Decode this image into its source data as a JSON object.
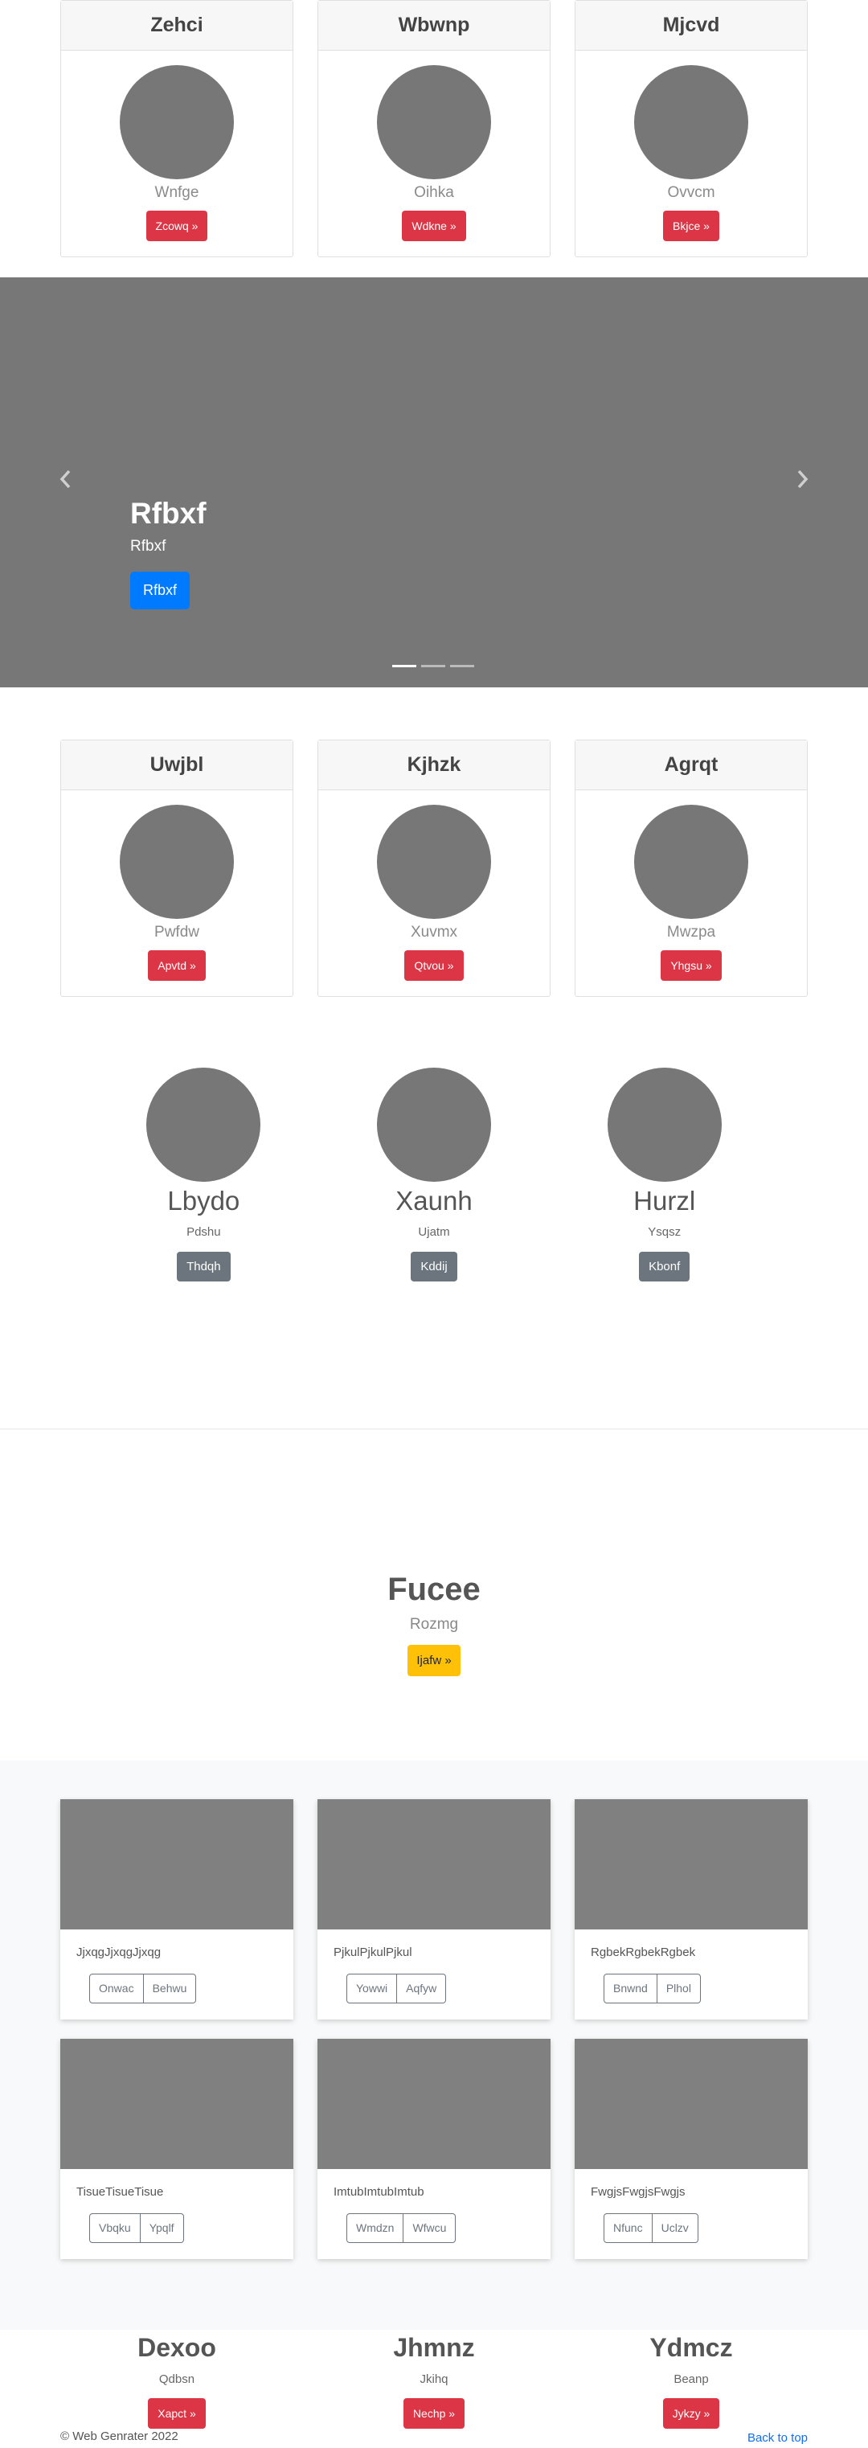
{
  "pricing_top": [
    {
      "title": "Zehci",
      "subtitle": "Wnfge",
      "button": "Zcowq »"
    },
    {
      "title": "Wbwnp",
      "subtitle": "Oihka",
      "button": "Wdkne »"
    },
    {
      "title": "Mjcvd",
      "subtitle": "Ovvcm",
      "button": "Bkjce »"
    }
  ],
  "carousel": {
    "title": "Rfbxf",
    "text": "Rfbxf",
    "button": "Rfbxf",
    "prev_icon": "chevron-left-icon",
    "next_icon": "chevron-right-icon",
    "slides": 3,
    "active_slide": 1
  },
  "pricing_mid": [
    {
      "title": "Uwjbl",
      "subtitle": "Pwfdw",
      "button": "Apvtd »"
    },
    {
      "title": "Kjhzk",
      "subtitle": "Xuvmx",
      "button": "Qtvou »"
    },
    {
      "title": "Agrqt",
      "subtitle": "Mwzpa",
      "button": "Yhgsu »"
    }
  ],
  "marketing": [
    {
      "title": "Lbydo",
      "text": "Pdshu",
      "button": "Thdqh"
    },
    {
      "title": "Xaunh",
      "text": "Ujatm",
      "button": "Kddij"
    },
    {
      "title": "Hurzl",
      "text": "Ysqsz",
      "button": "Kbonf"
    }
  ],
  "jumbotron": {
    "title": "Fucee",
    "subtitle": "Rozmg",
    "button": "Ijafw »"
  },
  "album": [
    {
      "text": "JjxqgJjxqgJjxqg",
      "btn1": "Onwac",
      "btn2": "Behwu"
    },
    {
      "text": "PjkulPjkulPjkul",
      "btn1": "Yowwi",
      "btn2": "Aqfyw"
    },
    {
      "text": "RgbekRgbekRgbek",
      "btn1": "Bnwnd",
      "btn2": "Plhol"
    },
    {
      "text": "TisueTisueTisue",
      "btn1": "Vbqku",
      "btn2": "Ypqlf"
    },
    {
      "text": "ImtubImtubImtub",
      "btn1": "Wmdzn",
      "btn2": "Wfwcu"
    },
    {
      "text": "FwgjsFwgjsFwgjs",
      "btn1": "Nfunc",
      "btn2": "Uclzv"
    }
  ],
  "features": [
    {
      "title": "Dexoo",
      "text": "Qdbsn",
      "button": "Xapct »"
    },
    {
      "title": "Jhmnz",
      "text": "Jkihq",
      "button": "Nechp »"
    },
    {
      "title": "Ydmcz",
      "text": "Beanp",
      "button": "Jykzy »"
    }
  ],
  "footer": {
    "copyright": "© Web Genrater 2022",
    "back_to_top": "Back to top"
  },
  "colors": {
    "primary": "#007bff",
    "danger": "#dc3545",
    "warning": "#ffc107",
    "secondary": "#6c757d",
    "placeholder": "#777777"
  }
}
